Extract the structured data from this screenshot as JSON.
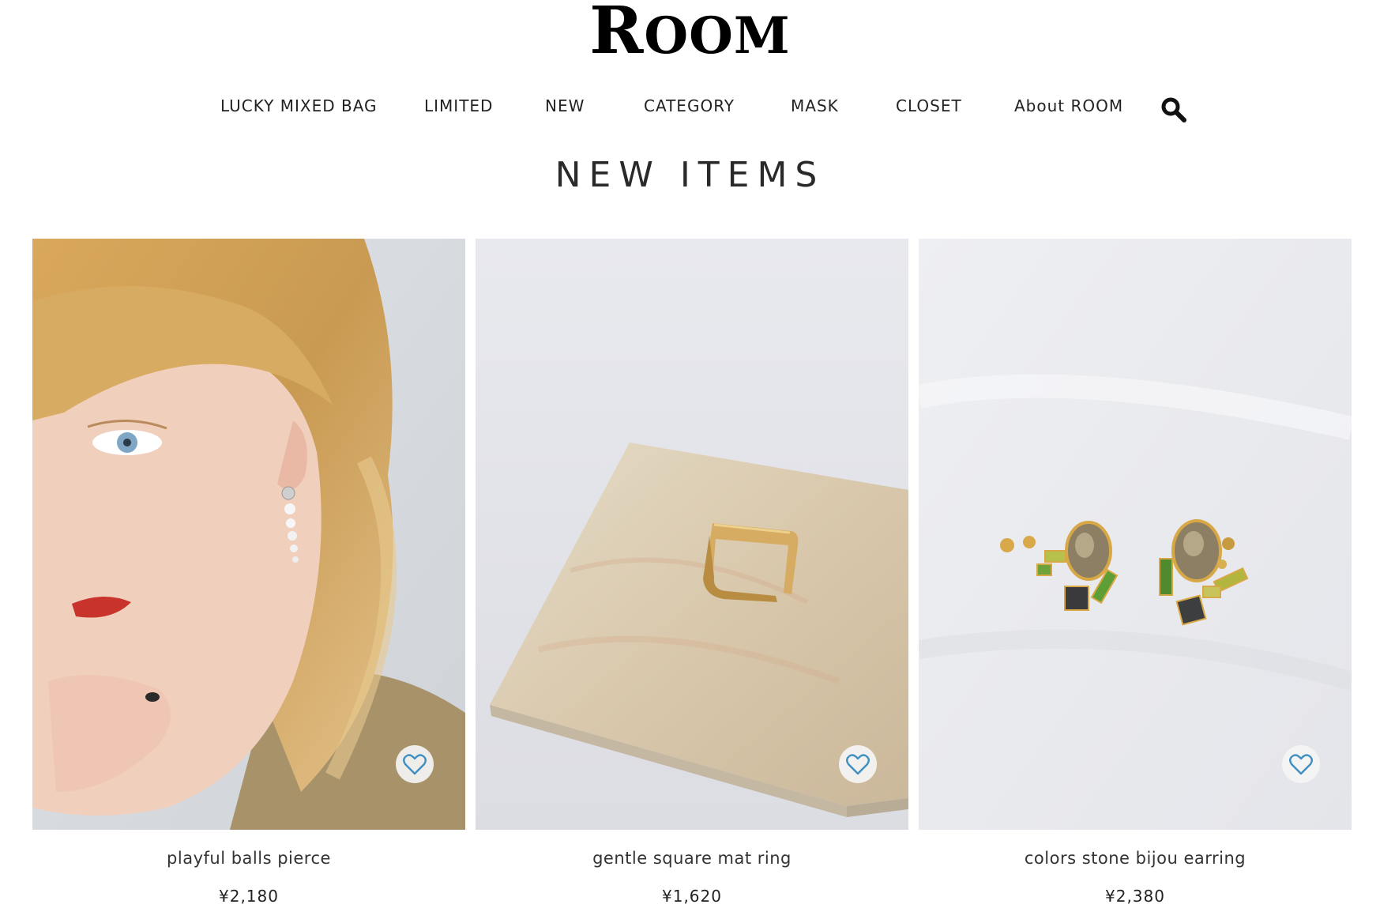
{
  "brand": {
    "logo_first": "R",
    "logo_rest": "OOM"
  },
  "nav": {
    "items": [
      {
        "label": "LUCKY MIXED BAG"
      },
      {
        "label": "LIMITED"
      },
      {
        "label": "NEW"
      },
      {
        "label": "CATEGORY"
      },
      {
        "label": "MASK"
      },
      {
        "label": "CLOSET"
      },
      {
        "label": "About ROOM"
      }
    ],
    "search_icon": "search-icon"
  },
  "section": {
    "title": "NEW ITEMS"
  },
  "products": [
    {
      "name": "playful balls pierce",
      "price": "¥2,180",
      "favorite_icon": "heart-icon"
    },
    {
      "name": "gentle square mat ring",
      "price": "¥1,620",
      "favorite_icon": "heart-icon"
    },
    {
      "name": "colors stone bijou earring",
      "price": "¥2,380",
      "favorite_icon": "heart-icon"
    }
  ],
  "colors": {
    "heart_accent": "#3f8fc0",
    "text": "#222222"
  }
}
